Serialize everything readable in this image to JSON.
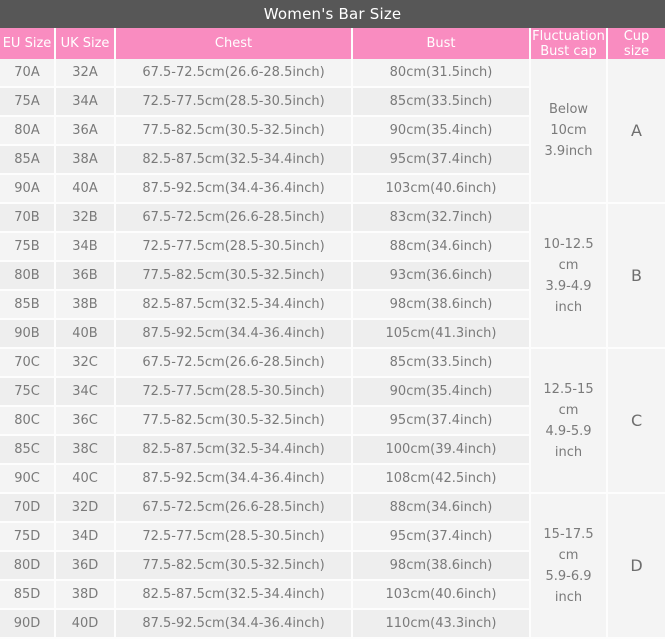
{
  "title": "Women's Bar Size",
  "columns": {
    "eu": "EU Size",
    "uk": "UK Size",
    "chest": "Chest",
    "bust": "Bust",
    "fluctuation_line1": "Fluctuation",
    "fluctuation_line2": "Bust cap",
    "cup_line1": "Cup",
    "cup_line2": "size"
  },
  "colors": {
    "title_bar": "#575757",
    "header_pink": "#f98cc0",
    "row_light": "#f4f4f4",
    "row_alt": "#eeeeee",
    "text_gray": "#7a7a7a",
    "grid_line": "#fdfdfd"
  },
  "groups": [
    {
      "cup": "A",
      "fluctuation": "Below\n10cm\n3.9inch",
      "fluctuation_lines": [
        "Below",
        "10cm",
        "3.9inch"
      ],
      "rows": [
        {
          "eu": "70A",
          "uk": "32A",
          "chest": "67.5-72.5cm(26.6-28.5inch)",
          "bust": "80cm(31.5inch)"
        },
        {
          "eu": "75A",
          "uk": "34A",
          "chest": "72.5-77.5cm(28.5-30.5inch)",
          "bust": "85cm(33.5inch)"
        },
        {
          "eu": "80A",
          "uk": "36A",
          "chest": "77.5-82.5cm(30.5-32.5inch)",
          "bust": "90cm(35.4inch)"
        },
        {
          "eu": "85A",
          "uk": "38A",
          "chest": "82.5-87.5cm(32.5-34.4inch)",
          "bust": "95cm(37.4inch)"
        },
        {
          "eu": "90A",
          "uk": "40A",
          "chest": "87.5-92.5cm(34.4-36.4inch)",
          "bust": "103cm(40.6inch)"
        }
      ]
    },
    {
      "cup": "B",
      "fluctuation": "10-12.5\ncm\n3.9-4.9\ninch",
      "fluctuation_lines": [
        "10-12.5",
        "cm",
        "3.9-4.9",
        "inch"
      ],
      "rows": [
        {
          "eu": "70B",
          "uk": "32B",
          "chest": "67.5-72.5cm(26.6-28.5inch)",
          "bust": "83cm(32.7inch)"
        },
        {
          "eu": "75B",
          "uk": "34B",
          "chest": "72.5-77.5cm(28.5-30.5inch)",
          "bust": "88cm(34.6inch)"
        },
        {
          "eu": "80B",
          "uk": "36B",
          "chest": "77.5-82.5cm(30.5-32.5inch)",
          "bust": "93cm(36.6inch)"
        },
        {
          "eu": "85B",
          "uk": "38B",
          "chest": "82.5-87.5cm(32.5-34.4inch)",
          "bust": "98cm(38.6inch)"
        },
        {
          "eu": "90B",
          "uk": "40B",
          "chest": "87.5-92.5cm(34.4-36.4inch)",
          "bust": "105cm(41.3inch)"
        }
      ]
    },
    {
      "cup": "C",
      "fluctuation": "12.5-15\ncm\n4.9-5.9\ninch",
      "fluctuation_lines": [
        "12.5-15",
        "cm",
        "4.9-5.9",
        "inch"
      ],
      "rows": [
        {
          "eu": "70C",
          "uk": "32C",
          "chest": "67.5-72.5cm(26.6-28.5inch)",
          "bust": "85cm(33.5inch)"
        },
        {
          "eu": "75C",
          "uk": "34C",
          "chest": "72.5-77.5cm(28.5-30.5inch)",
          "bust": "90cm(35.4inch)"
        },
        {
          "eu": "80C",
          "uk": "36C",
          "chest": "77.5-82.5cm(30.5-32.5inch)",
          "bust": "95cm(37.4inch)"
        },
        {
          "eu": "85C",
          "uk": "38C",
          "chest": "82.5-87.5cm(32.5-34.4inch)",
          "bust": "100cm(39.4inch)"
        },
        {
          "eu": "90C",
          "uk": "40C",
          "chest": "87.5-92.5cm(34.4-36.4inch)",
          "bust": "108cm(42.5inch)"
        }
      ]
    },
    {
      "cup": "D",
      "fluctuation": "15-17.5\ncm\n5.9-6.9\ninch",
      "fluctuation_lines": [
        "15-17.5",
        "cm",
        "5.9-6.9",
        "inch"
      ],
      "rows": [
        {
          "eu": "70D",
          "uk": "32D",
          "chest": "67.5-72.5cm(26.6-28.5inch)",
          "bust": "88cm(34.6inch)"
        },
        {
          "eu": "75D",
          "uk": "34D",
          "chest": "72.5-77.5cm(28.5-30.5inch)",
          "bust": "95cm(37.4inch)"
        },
        {
          "eu": "80D",
          "uk": "36D",
          "chest": "77.5-82.5cm(30.5-32.5inch)",
          "bust": "98cm(38.6inch)"
        },
        {
          "eu": "85D",
          "uk": "38D",
          "chest": "82.5-87.5cm(32.5-34.4inch)",
          "bust": "103cm(40.6inch)"
        },
        {
          "eu": "90D",
          "uk": "40D",
          "chest": "87.5-92.5cm(34.4-36.4inch)",
          "bust": "110cm(43.3inch)"
        }
      ]
    }
  ]
}
